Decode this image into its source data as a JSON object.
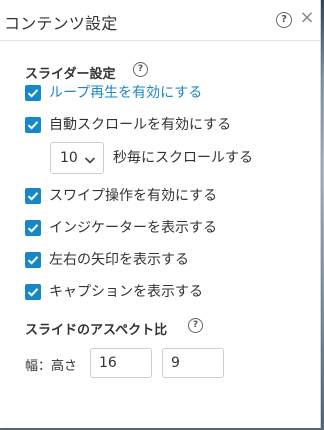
{
  "header": {
    "title": "コンテンツ設定",
    "help_glyph": "?",
    "close_glyph": "×"
  },
  "slider_settings": {
    "title": "スライダー設定",
    "help_glyph": "?",
    "loop_label": "ループ再生を有効にする",
    "loop_checked": true,
    "autoscroll_label": "自動スクロールを有効にする",
    "autoscroll_checked": true,
    "interval_value": "10",
    "interval_suffix": "秒毎にスクロールする",
    "swipe_label": "スワイプ操作を有効にする",
    "swipe_checked": true,
    "indicator_label": "インジケーターを表示する",
    "indicator_checked": true,
    "arrows_label": "左右の矢印を表示する",
    "arrows_checked": true,
    "caption_label": "キャプションを表示する",
    "caption_checked": true
  },
  "aspect_ratio": {
    "title": "スライドのアスペクト比",
    "help_glyph": "?",
    "label": "幅：高さ",
    "width_value": "16",
    "height_value": "9"
  },
  "colors": {
    "accent": "#1688c9",
    "text": "#333333"
  }
}
